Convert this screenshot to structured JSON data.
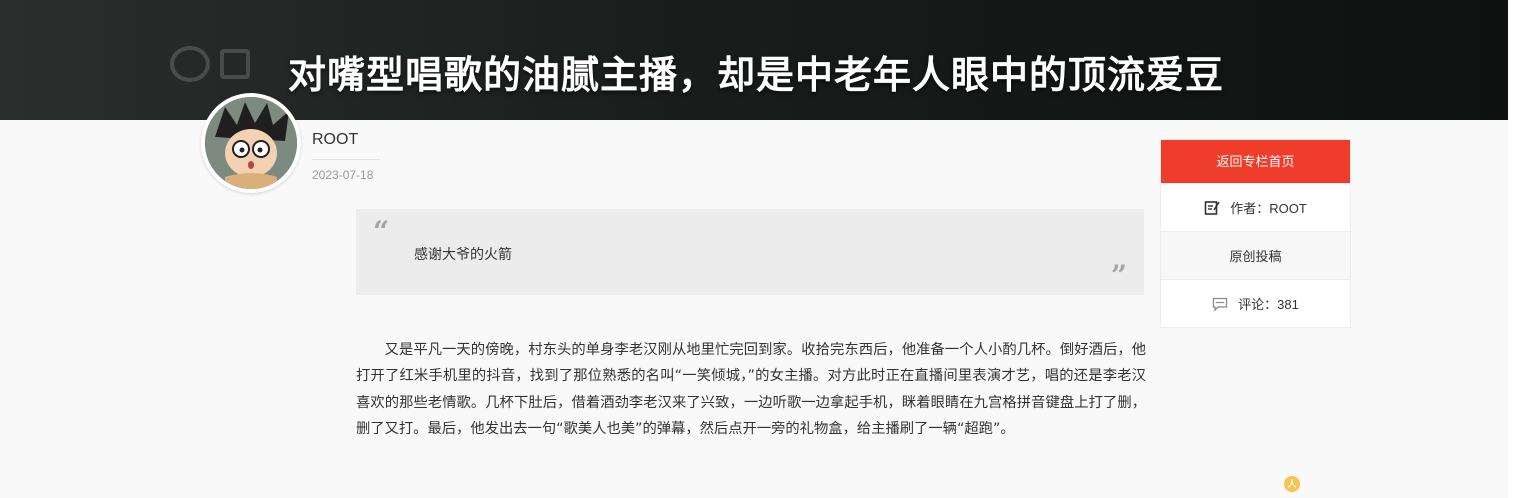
{
  "hero": {
    "title": "对嘴型唱歌的油腻主播，却是中老年人眼中的顶流爱豆"
  },
  "author": {
    "name": "ROOT",
    "date": "2023-07-18",
    "avatar_icon": "cartoon-avatar"
  },
  "quote": {
    "open_mark": "“",
    "close_mark": "”",
    "text": "感谢大爷的火箭"
  },
  "article": {
    "paragraph": "又是平凡一天的傍晚，村东头的单身李老汉刚从地里忙完回到家。收拾完东西后，他准备一个人小酌几杯。倒好酒后，他打开了红米手机里的抖音，找到了那位熟悉的名叫“一笑倾城，”的女主播。对方此时正在直播间里表演才艺，唱的还是李老汉喜欢的那些老情歌。几杯下肚后，借着酒劲李老汉来了兴致，一边听歌一边拿起手机，眯着眼睛在九宫格拼音键盘上打了删，删了又打。最后，他发出去一句“歌美人也美”的弹幕，然后点开一旁的礼物盒，给主播刷了一辆“超跑”。"
  },
  "sidebar": {
    "back_label": "返回专栏首页",
    "author_label": "作者：ROOT",
    "original_label": "原创投稿",
    "comments_label": "评论：381",
    "accent_color": "#ee3d2a"
  },
  "float_badge": {
    "text": "人"
  }
}
